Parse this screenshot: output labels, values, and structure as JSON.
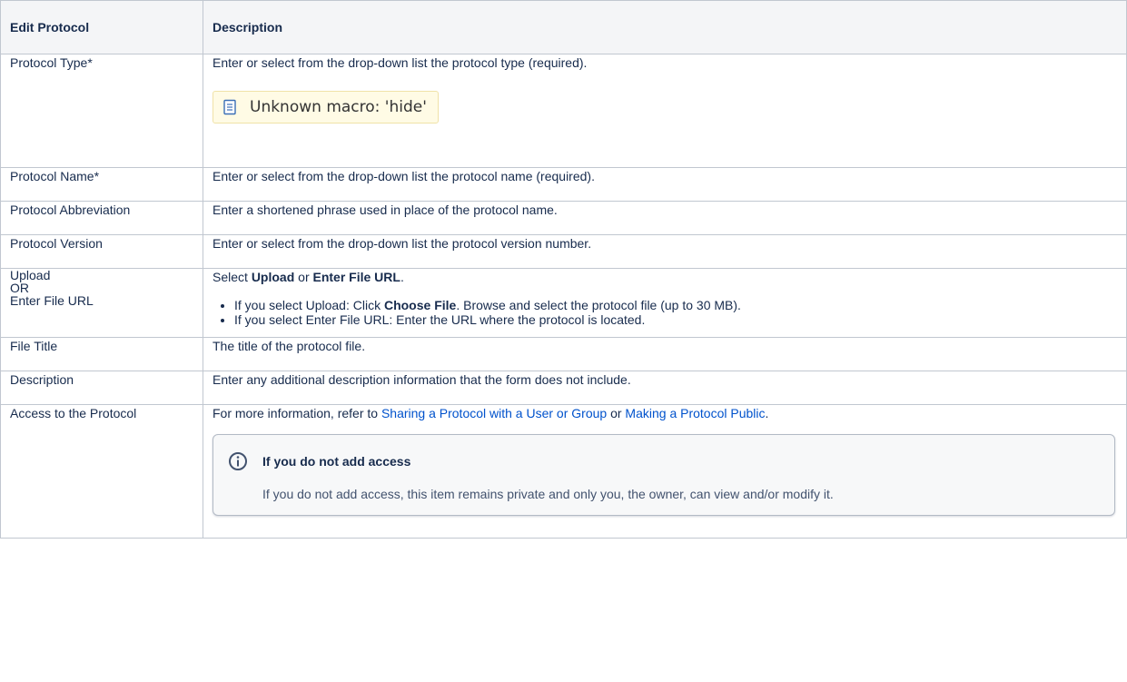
{
  "headers": {
    "col1": "Edit Protocol",
    "col2": "Description"
  },
  "colors": {
    "header_bg": "#f4f5f7",
    "border": "#c1c7d0",
    "link": "#0052cc",
    "macro_bg": "#fffbe5"
  },
  "rows": {
    "type": {
      "label": "Protocol Type*",
      "desc": "Enter or select from the drop-down list the protocol type (required).",
      "macro": "Unknown macro: 'hide'"
    },
    "name": {
      "label": "Protocol Name*",
      "desc": "Enter or select from the drop-down list the protocol name (required)."
    },
    "abbr": {
      "label": "Protocol Abbreviation",
      "desc": "Enter a shortened phrase used in place of the protocol name."
    },
    "version": {
      "label": "Protocol Version",
      "desc": "Enter or select from the drop-down list the protocol version number."
    },
    "upload": {
      "label_line1": "Upload",
      "label_line2": "OR",
      "label_line3": "Enter File URL",
      "intro_pre": "Select ",
      "intro_b1": "Upload",
      "intro_mid": " or ",
      "intro_b2": "Enter File URL",
      "intro_end": ".",
      "bullet1_pre": "If you select Upload: Click ",
      "bullet1_b": "Choose File",
      "bullet1_post": ". Browse and select the protocol file (up to 30 MB).",
      "bullet2": "If you select Enter File URL: Enter the URL where the protocol is located."
    },
    "file_title": {
      "label": "File Title",
      "desc": "The title of the protocol file."
    },
    "description": {
      "label": "Description",
      "desc": "Enter any additional description information that the form does not include."
    },
    "access": {
      "label": "Access to the Protocol",
      "intro_pre": "For more information, refer to ",
      "link1": "Sharing a Protocol with a User or Group",
      "intro_mid": " or ",
      "link2": "Making a Protocol Public",
      "intro_end": ".",
      "info_title": "If you do not add access",
      "info_body": "If you do not add access, this item remains private and only you, the owner, can view and/or modify it.",
      "info_icon": "info-icon"
    }
  }
}
